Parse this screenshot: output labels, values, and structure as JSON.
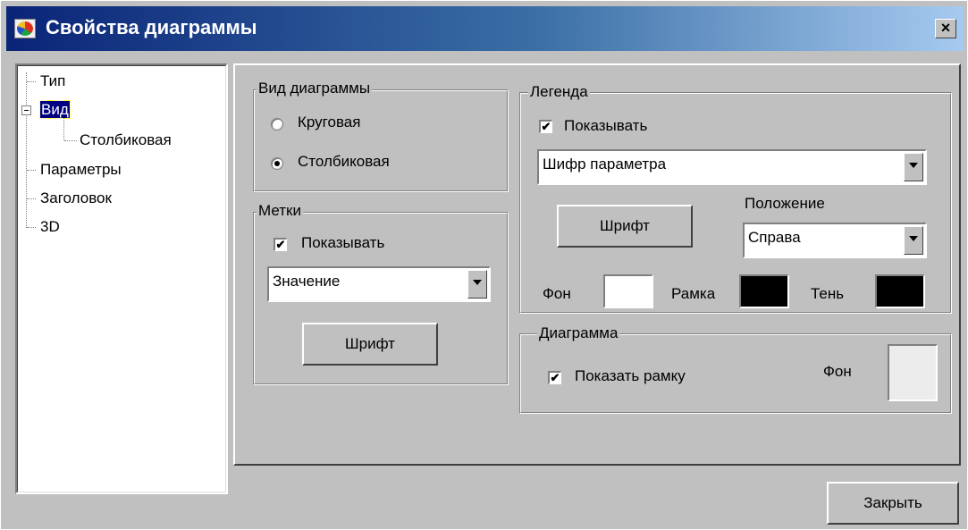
{
  "window": {
    "title": "Свойства диаграммы",
    "close_symbol": "×"
  },
  "tree": {
    "items": [
      {
        "label": "Тип"
      },
      {
        "label": "Вид"
      },
      {
        "label": "Столбиковая"
      },
      {
        "label": "Параметры"
      },
      {
        "label": "Заголовок"
      },
      {
        "label": "3D"
      }
    ],
    "selected": "Вид"
  },
  "chart_view": {
    "group_label": "Вид диаграммы",
    "option_pie": "Круговая",
    "option_bar": "Столбиковая",
    "selected": "Столбиковая"
  },
  "labels": {
    "group_label": "Метки",
    "show_label": "Показывать",
    "show_checked": true,
    "select_value": "Значение",
    "font_button": "Шрифт"
  },
  "legend": {
    "group_label": "Легенда",
    "show_label": "Показывать",
    "show_checked": true,
    "select_value": "Шифр параметра",
    "font_button": "Шрифт",
    "position_label": "Положение",
    "position_value": "Справа",
    "bg_label": "Фон",
    "bg_color": "#ffffff",
    "frame_label": "Рамка",
    "frame_color": "#000000",
    "shadow_label": "Тень",
    "shadow_color": "#000000"
  },
  "diagram": {
    "group_label": "Диаграмма",
    "show_frame_label": "Показать рамку",
    "show_frame_checked": true,
    "bg_label": "Фон",
    "bg_color": "#ececec"
  },
  "footer": {
    "close_button": "Закрыть"
  },
  "check_mark": "✔"
}
